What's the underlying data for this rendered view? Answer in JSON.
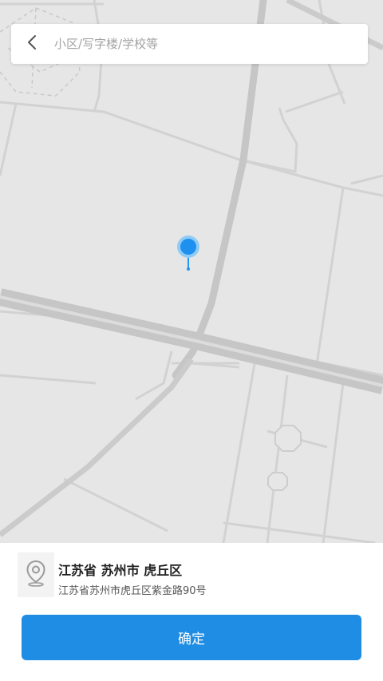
{
  "search": {
    "placeholder": "小区/写字楼/学校等",
    "value": ""
  },
  "icons": {
    "back": "chevron-left-icon",
    "pin": "map-pin-icon",
    "location": "location-pin-icon"
  },
  "location": {
    "title": "江苏省 苏州市 虎丘区",
    "address": "江苏省苏州市虎丘区紫金路90号"
  },
  "confirm_label": "确定",
  "colors": {
    "accent": "#1f8de3",
    "pin": "#2196f3",
    "map_background": "#e7e7e7",
    "road": "#cfcfcf"
  }
}
